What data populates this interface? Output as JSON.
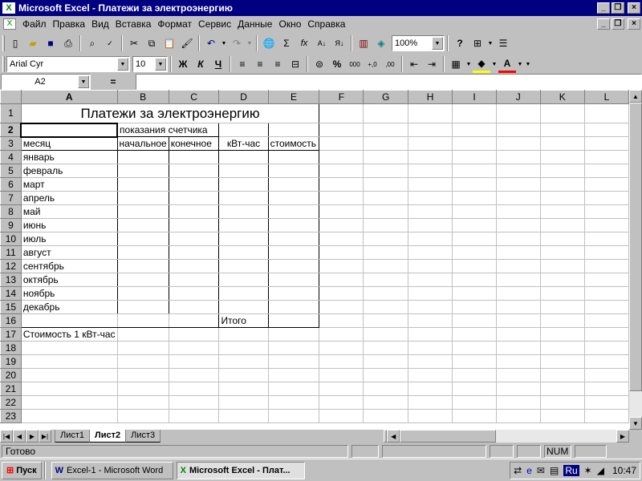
{
  "window": {
    "title": "Microsoft Excel - Платежи за электроэнергию"
  },
  "menu": [
    "Файл",
    "Правка",
    "Вид",
    "Вставка",
    "Формат",
    "Сервис",
    "Данные",
    "Окно",
    "Справка"
  ],
  "toolbar": {
    "zoom": "100%",
    "font_name": "Arial Cyr",
    "font_size": "10",
    "bold": "Ж",
    "italic": "К",
    "underline": "Ч",
    "percent": "%",
    "thousands": "000",
    "inc_decimal": "+,0",
    "dec_decimal": ",00",
    "sum": "Σ",
    "fx": "fx"
  },
  "formula_bar": {
    "name_box": "A2",
    "equals": "=",
    "value": ""
  },
  "columns": [
    "A",
    "B",
    "C",
    "D",
    "E",
    "F",
    "G",
    "H",
    "I",
    "J",
    "K",
    "L"
  ],
  "rows": [
    "1",
    "2",
    "3",
    "4",
    "5",
    "6",
    "7",
    "8",
    "9",
    "10",
    "11",
    "12",
    "13",
    "14",
    "15",
    "16",
    "17",
    "18",
    "19",
    "20",
    "21",
    "22",
    "23"
  ],
  "sheet": {
    "title": "Платежи за электроэнергию",
    "meter_readings": "показания счетчика",
    "col_month": "месяц",
    "col_start": "начальное",
    "col_end": "конечное",
    "col_kwh": "кВт-час",
    "col_cost": "стоимость",
    "months": [
      "январь",
      "февраль",
      "март",
      "апрель",
      "май",
      "июнь",
      "июль",
      "август",
      "сентябрь",
      "октябрь",
      "ноябрь",
      "декабрь"
    ],
    "total": "Итого",
    "rate_label": "Стоимость 1 кВт-час"
  },
  "tabs": [
    "Лист1",
    "Лист2",
    "Лист3"
  ],
  "active_tab": "Лист2",
  "status": {
    "ready": "Готово",
    "num": "NUM"
  },
  "taskbar": {
    "start": "Пуск",
    "tasks": [
      "Excel-1 - Microsoft Word",
      "Microsoft Excel - Плат..."
    ],
    "lang": "Ru",
    "clock": "10:47"
  }
}
